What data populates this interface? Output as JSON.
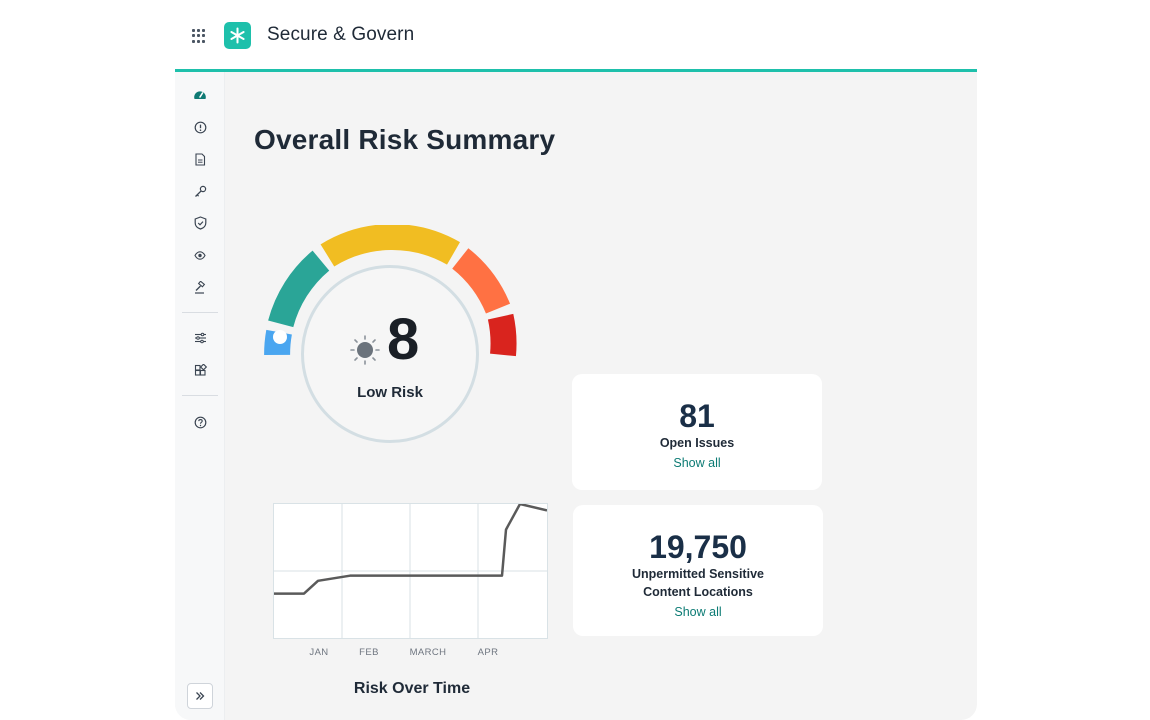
{
  "app": {
    "title": "Secure & Govern"
  },
  "sidebar": {
    "items": [
      {
        "icon": "dashboard-gauge-icon"
      },
      {
        "icon": "alert-circle-icon"
      },
      {
        "icon": "document-icon"
      },
      {
        "icon": "key-icon"
      },
      {
        "icon": "shield-check-icon"
      },
      {
        "icon": "eye-refresh-icon"
      },
      {
        "icon": "gavel-icon"
      },
      {
        "icon": "sliders-icon"
      },
      {
        "icon": "integrations-icon"
      },
      {
        "icon": "help-icon"
      }
    ],
    "collapse_icon": "double-chevron-right-icon"
  },
  "main": {
    "title": "Overall Risk Summary",
    "risk": {
      "score": "8",
      "level": "Low Risk",
      "icon": "sun-icon"
    },
    "chart": {
      "title": "Risk Over Time",
      "ticks": [
        "JAN",
        "FEB",
        "MARCH",
        "APR"
      ]
    },
    "cards": [
      {
        "value": "81",
        "label_line1": "Open Issues",
        "label_line2": "",
        "link": "Show all"
      },
      {
        "value": "19,750",
        "label_line1": "Unpermitted Sensitive",
        "label_line2": "Content Locations",
        "link": "Show all"
      }
    ]
  },
  "colors": {
    "accent": "#1ec0ab",
    "link": "#0c7b74",
    "gauge_blue": "#4aa6f0",
    "gauge_teal": "#2aa597",
    "gauge_yellow": "#f1bd22",
    "gauge_orange": "#ff7143",
    "gauge_red": "#d9241e"
  },
  "chart_data": {
    "type": "line",
    "title": "Risk Over Time",
    "xlabel": "",
    "ylabel": "",
    "categories": [
      "JAN",
      "FEB",
      "MARCH",
      "APR"
    ],
    "series": [
      {
        "values": [
          3,
          3,
          4,
          4.4,
          4.4,
          4.4,
          4.4,
          4.4,
          4.4,
          8,
          10,
          9.5
        ]
      }
    ],
    "grid": true,
    "ylim": [
      0,
      10
    ]
  }
}
